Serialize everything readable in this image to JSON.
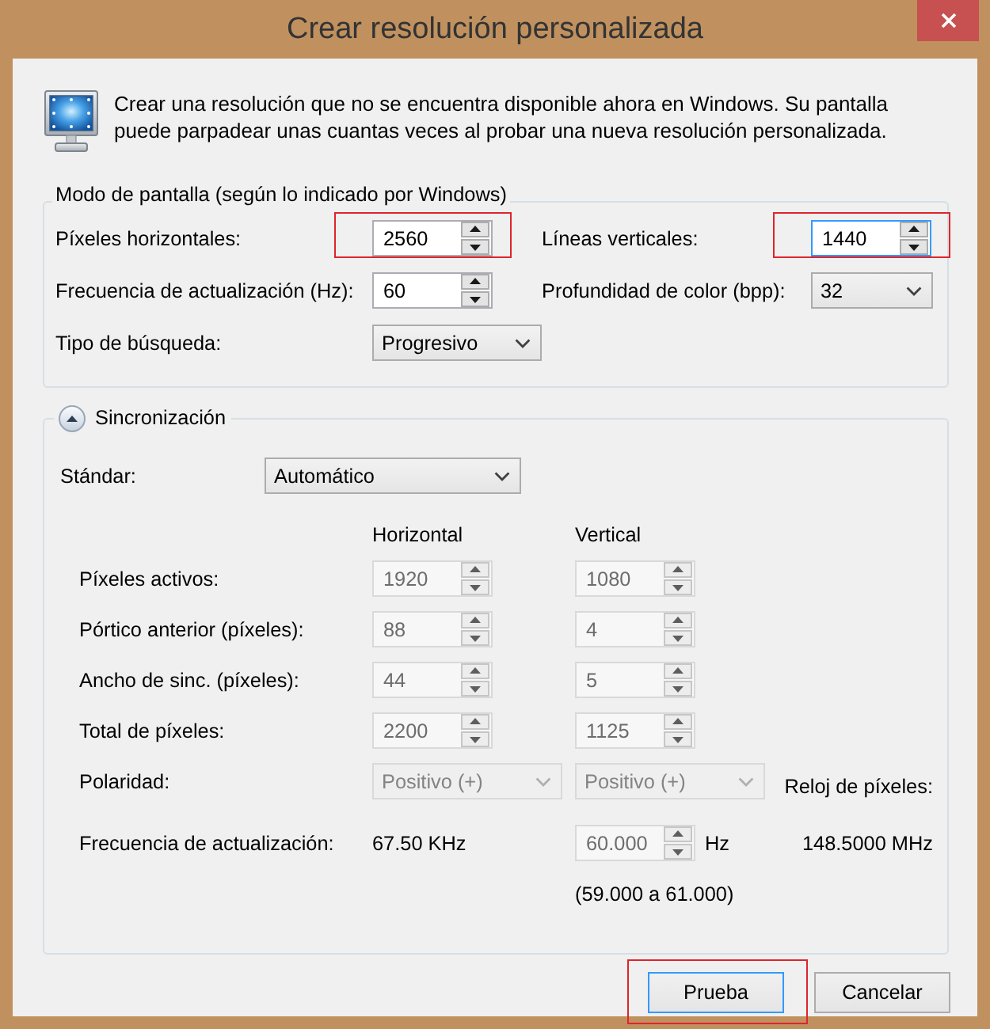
{
  "window": {
    "title": "Crear resolución personalizada"
  },
  "intro": {
    "text": "Crear una resolución que no se encuentra disponible ahora en Windows. Su pantalla puede parpadear unas cuantas veces al probar una nueva resolución personalizada."
  },
  "display_mode": {
    "title": "Modo de pantalla (según lo indicado por Windows)",
    "rows": [
      [
        {
          "label": "Píxeles horizontales:",
          "kind": "spinner",
          "value": "2560",
          "disabled": false,
          "focused": false,
          "highlighted": true
        },
        {
          "label": "Líneas verticales:",
          "kind": "spinner",
          "value": "1440",
          "disabled": false,
          "focused": true,
          "highlighted": true
        }
      ],
      [
        {
          "label": "Frecuencia de actualización (Hz):",
          "kind": "spinner",
          "value": "60",
          "disabled": false,
          "focused": false,
          "highlighted": false
        },
        {
          "label": "Profundidad de color (bpp):",
          "kind": "dropdown",
          "value": "32",
          "disabled": false,
          "focused": false,
          "highlighted": false
        }
      ],
      [
        {
          "label": "Tipo de búsqueda:",
          "kind": "dropdown",
          "value": "Progresivo",
          "disabled": false,
          "focused": false,
          "highlighted": false
        }
      ]
    ]
  },
  "sync": {
    "title": "Sincronización",
    "expanded": true,
    "standard": {
      "label": "Stándar:",
      "kind": "dropdown",
      "value": "Automático",
      "disabled": false
    },
    "columns": [
      "Horizontal",
      "Vertical"
    ],
    "rows": [
      {
        "label": "Píxeles activos:",
        "cells": [
          {
            "kind": "spinner",
            "value": "1920",
            "disabled": true
          },
          {
            "kind": "spinner",
            "value": "1080",
            "disabled": true
          }
        ]
      },
      {
        "label": "Pórtico anterior (píxeles):",
        "cells": [
          {
            "kind": "spinner",
            "value": "88",
            "disabled": true
          },
          {
            "kind": "spinner",
            "value": "4",
            "disabled": true
          }
        ]
      },
      {
        "label": "Ancho de sinc. (píxeles):",
        "cells": [
          {
            "kind": "spinner",
            "value": "44",
            "disabled": true
          },
          {
            "kind": "spinner",
            "value": "5",
            "disabled": true
          }
        ]
      },
      {
        "label": "Total de píxeles:",
        "cells": [
          {
            "kind": "spinner",
            "value": "2200",
            "disabled": true
          },
          {
            "kind": "spinner",
            "value": "1125",
            "disabled": true
          }
        ]
      },
      {
        "label": "Polaridad:",
        "cells": [
          {
            "kind": "dropdown",
            "value": "Positivo (+)",
            "disabled": true
          },
          {
            "kind": "dropdown",
            "value": "Positivo (+)",
            "disabled": true
          },
          {
            "kind": "label",
            "text": "Reloj de píxeles:"
          }
        ]
      },
      {
        "label": "Frecuencia de actualización:",
        "cells": [
          {
            "kind": "reading",
            "text": "67.50 KHz"
          },
          {
            "kind": "spinner",
            "value": "60.000",
            "disabled": true,
            "unit": "Hz"
          },
          {
            "kind": "reading",
            "text": "148.5000 MHz"
          }
        ]
      }
    ],
    "range": "(59.000 a 61.000)"
  },
  "buttons": [
    {
      "label": "Prueba",
      "default": true,
      "highlighted": true
    },
    {
      "label": "Cancelar",
      "default": false,
      "highlighted": false
    }
  ]
}
